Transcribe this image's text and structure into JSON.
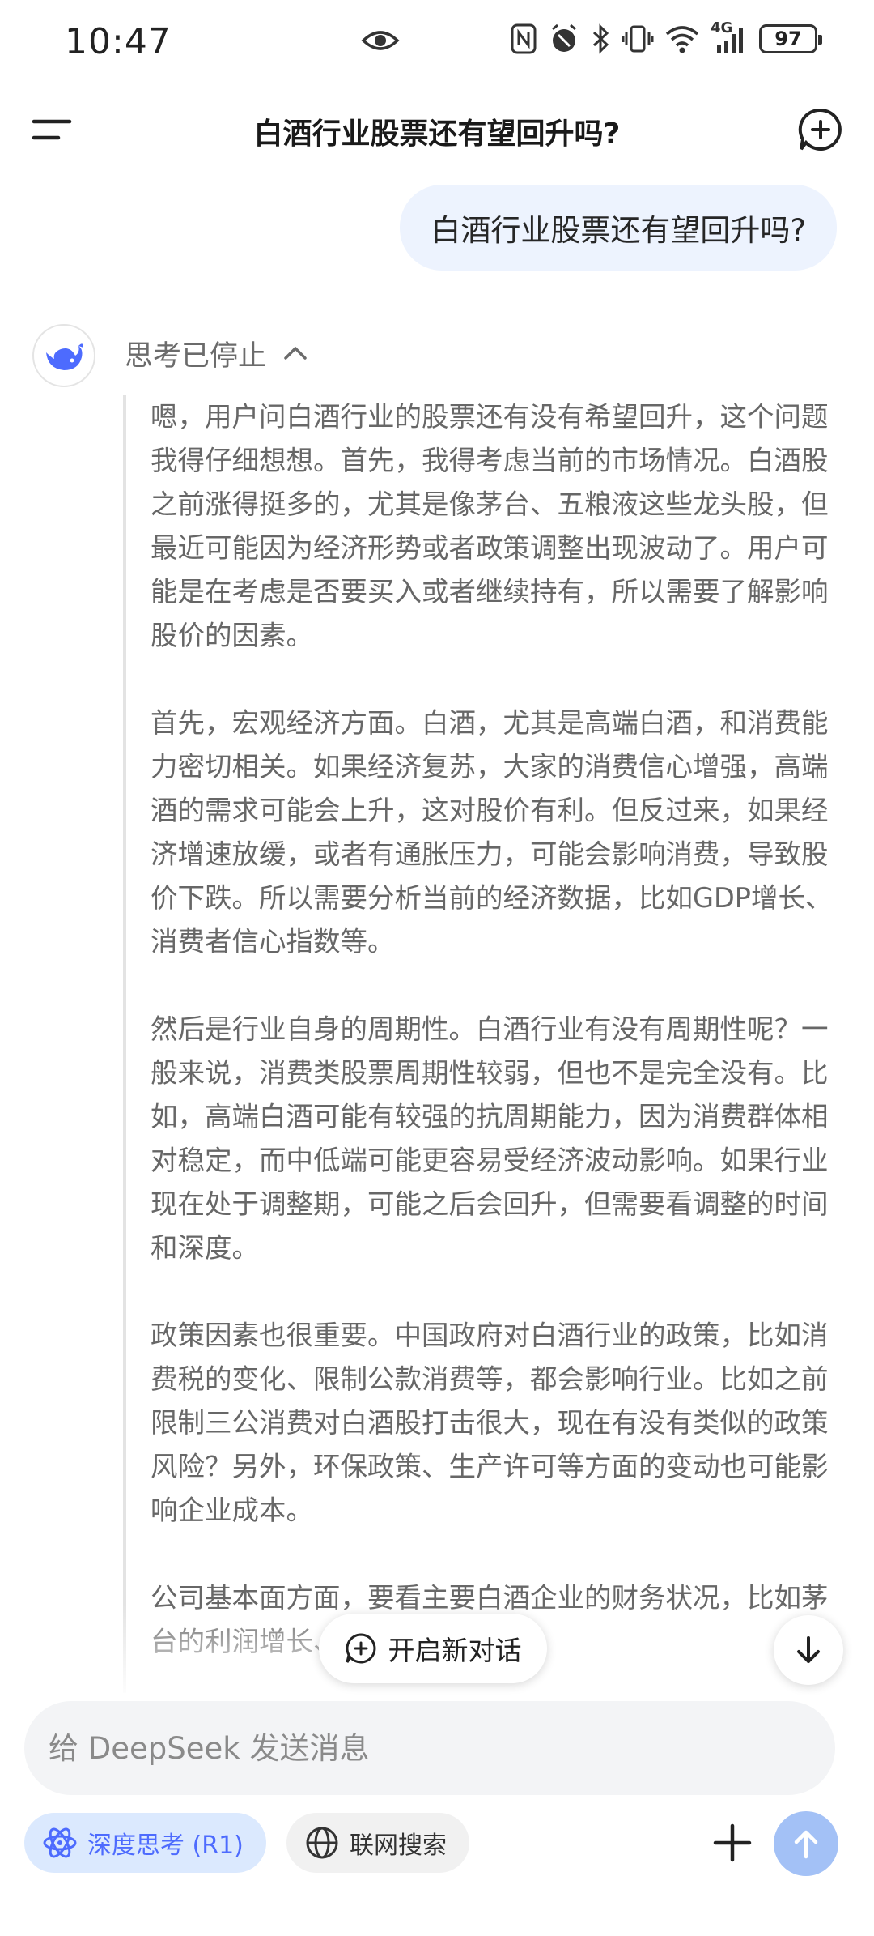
{
  "status_bar": {
    "time": "10:47",
    "battery": "97",
    "network": "4G"
  },
  "header": {
    "title": "白酒行业股票还有望回升吗?"
  },
  "user_message": "白酒行业股票还有望回升吗?",
  "assistant": {
    "think_label": "思考已停止",
    "paragraphs": [
      "嗯，用户问白酒行业的股票还有没有希望回升，这个问题我得仔细想想。首先，我得考虑当前的市场情况。白酒股之前涨得挺多的，尤其是像茅台、五粮液这些龙头股，但最近可能因为经济形势或者政策调整出现波动了。用户可能是在考虑是否要买入或者继续持有，所以需要了解影响股价的因素。",
      "首先，宏观经济方面。白酒，尤其是高端白酒，和消费能力密切相关。如果经济复苏，大家的消费信心增强，高端酒的需求可能会上升，这对股价有利。但反过来，如果经济增速放缓，或者有通胀压力，可能会影响消费，导致股价下跌。所以需要分析当前的经济数据，比如GDP增长、消费者信心指数等。",
      "然后是行业自身的周期性。白酒行业有没有周期性呢？一般来说，消费类股票周期性较弱，但也不是完全没有。比如，高端白酒可能有较强的抗周期能力，因为消费群体相对稳定，而中低端可能更容易受经济波动影响。如果行业现在处于调整期，可能之后会回升，但需要看调整的时间和深度。",
      "政策因素也很重要。中国政府对白酒行业的政策，比如消费税的变化、限制公款消费等，都会影响行业。比如之前限制三公消费对白酒股打击很大，现在有没有类似的政策风险？另外，环保政策、生产许可等方面的变动也可能影响企业成本。",
      "公司基本面方面，要看主要白酒企业的财务状况，比如茅台的利润增长、库存情况等。如"
    ]
  },
  "floating": {
    "new_conversation": "开启新对话"
  },
  "composer": {
    "placeholder": "给 DeepSeek 发送消息"
  },
  "chips": {
    "deep_think": "深度思考 (R1)",
    "web_search": "联网搜索"
  },
  "colors": {
    "accent": "#4d6bfe",
    "user_bubble": "#edf3fe",
    "send_button": "#a3c1f6"
  }
}
